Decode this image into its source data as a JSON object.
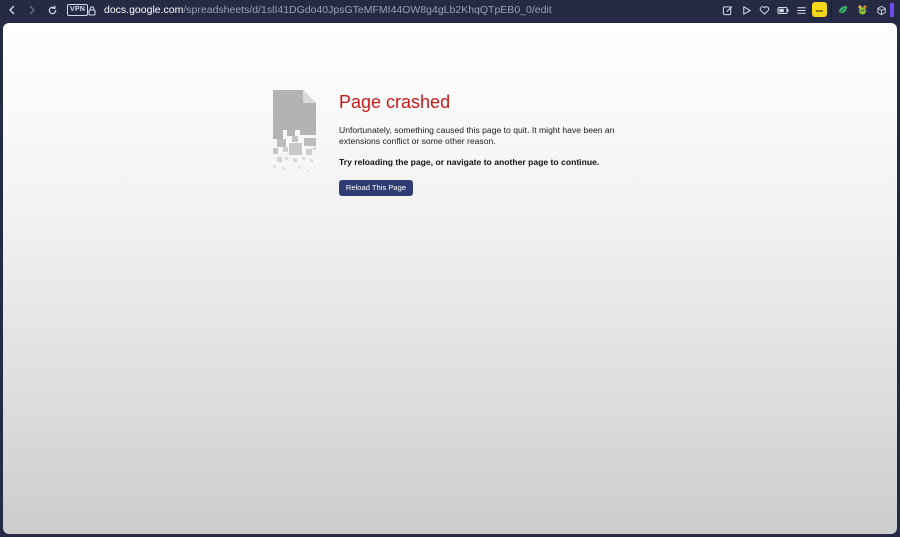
{
  "browser": {
    "vpn_label": "VPN",
    "url_domain": "docs.google.com",
    "url_path": "/spreadsheets/d/1slI41DGdo40JpsGTeMFMI44OW8g4gLb2KhqQTpEB0_0/edit",
    "icons": {
      "back": "chevron-left-icon",
      "forward": "chevron-right-icon",
      "reload": "reload-icon",
      "security": "lock-icon",
      "edit": "edit-icon",
      "play": "play-icon",
      "heart": "heart-icon",
      "battery": "battery-icon",
      "menu": "list-menu-icon",
      "extension_yellow": "extension-icon",
      "extension_green": "leaf-icon",
      "extension_mascot": "mascot-icon",
      "cube": "cube-icon"
    },
    "accent_color": "#6f4cf0"
  },
  "page": {
    "title": "Page crashed",
    "message": "Unfortunately, something caused this page to quit. It might have been an extensions conflict or some other reason.",
    "hint": "Try reloading the page, or navigate to another page to continue.",
    "reload_button": "Reload This Page",
    "title_color": "#c81a1a",
    "button_color": "#2f3c72"
  }
}
